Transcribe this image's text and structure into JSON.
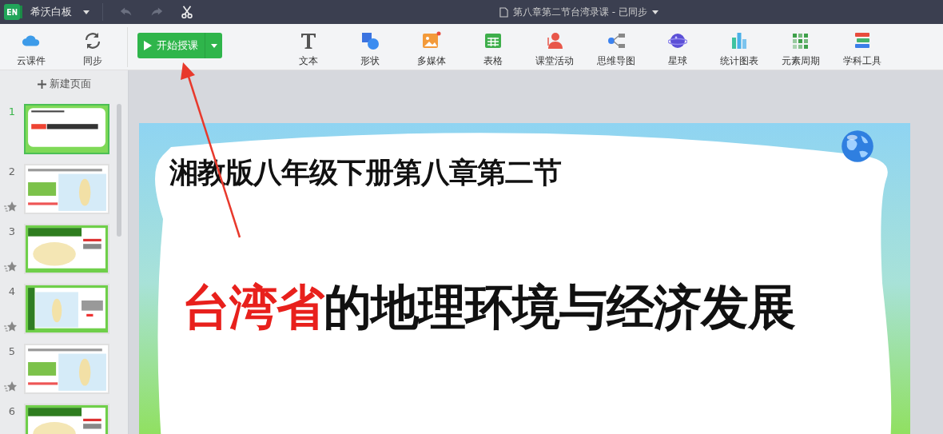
{
  "app": {
    "name": "希沃白板"
  },
  "document": {
    "title": "第八章第二节台湾录课 - 已同步"
  },
  "toolbar_left": [
    {
      "label": "云课件",
      "kind": "cloud"
    },
    {
      "label": "同步",
      "kind": "sync"
    }
  ],
  "start_button": {
    "label": "开始授课"
  },
  "tools": [
    {
      "label": "文本",
      "kind": "text"
    },
    {
      "label": "形状",
      "kind": "shape"
    },
    {
      "label": "多媒体",
      "kind": "media"
    },
    {
      "label": "表格",
      "kind": "table"
    },
    {
      "label": "课堂活动",
      "kind": "activity"
    },
    {
      "label": "思维导图",
      "kind": "mindmap"
    },
    {
      "label": "星球",
      "kind": "planet"
    },
    {
      "label": "统计图表",
      "kind": "chart"
    },
    {
      "label": "元素周期",
      "kind": "periodic"
    },
    {
      "label": "学科工具",
      "kind": "books"
    }
  ],
  "sidebar": {
    "new_page": "新建页面",
    "pages": [
      {
        "number": "1",
        "selected": true,
        "starred": false
      },
      {
        "number": "2",
        "selected": false,
        "starred": true
      },
      {
        "number": "3",
        "selected": false,
        "starred": true
      },
      {
        "number": "4",
        "selected": false,
        "starred": true
      },
      {
        "number": "5",
        "selected": false,
        "starred": true
      },
      {
        "number": "6",
        "selected": false,
        "starred": false
      }
    ]
  },
  "slide": {
    "subtitle": "湘教版八年级下册第八章第二节",
    "title_highlight": "台湾省",
    "title_rest": "的地理环境与经济发展"
  }
}
